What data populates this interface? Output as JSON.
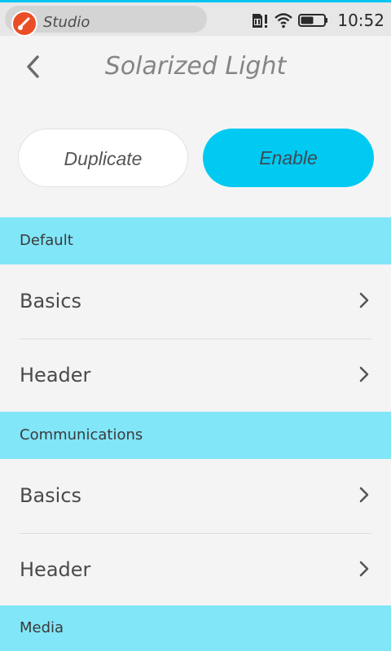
{
  "status_bar": {
    "app_name": "Studio",
    "time": "10:52",
    "icons": [
      "sim-alert-icon",
      "wifi-icon",
      "battery-icon"
    ]
  },
  "header": {
    "title": "Solarized Light",
    "back_icon": "chevron-left-icon"
  },
  "actions": {
    "duplicate_label": "Duplicate",
    "enable_label": "Enable"
  },
  "sections": [
    {
      "title": "Default",
      "items": [
        {
          "label": "Basics"
        },
        {
          "label": "Header"
        }
      ]
    },
    {
      "title": "Communications",
      "items": [
        {
          "label": "Basics"
        },
        {
          "label": "Header"
        }
      ]
    },
    {
      "title": "Media",
      "items": []
    }
  ],
  "colors": {
    "accent": "#00caf2",
    "section_bg": "#81e6f8",
    "background": "#f4f4f4",
    "app_icon": "#ea4e27"
  }
}
